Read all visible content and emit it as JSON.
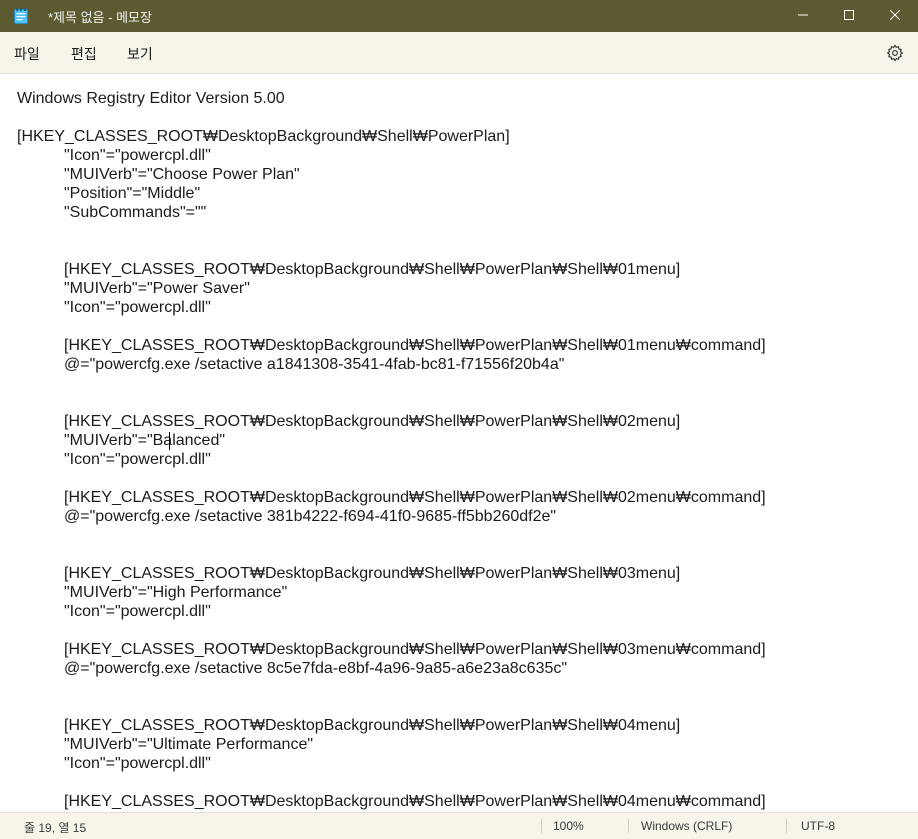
{
  "window": {
    "title": "*제목 없음 - 메모장",
    "icon": "notepad-icon",
    "controls": {
      "minimize_icon": "minimize-icon",
      "maximize_icon": "maximize-icon",
      "close_icon": "close-icon"
    },
    "titlebar_color": "#5b5a31"
  },
  "menu": {
    "items": [
      "파일",
      "편집",
      "보기"
    ],
    "settings_icon": "gear-icon",
    "background_color": "#f7f4ea"
  },
  "editor": {
    "lines": [
      "Windows Registry Editor Version 5.00",
      "",
      "[HKEY_CLASSES_ROOT₩DesktopBackground₩Shell₩PowerPlan]",
      "\"Icon\"=\"powercpl.dll\"",
      "\"MUIVerb\"=\"Choose Power Plan\"",
      "\"Position\"=\"Middle\"",
      "\"SubCommands\"=\"\"",
      "",
      "",
      "[HKEY_CLASSES_ROOT₩DesktopBackground₩Shell₩PowerPlan₩Shell₩01menu]",
      "\"MUIVerb\"=\"Power Saver\"",
      "\"Icon\"=\"powercpl.dll\"",
      "",
      "[HKEY_CLASSES_ROOT₩DesktopBackground₩Shell₩PowerPlan₩Shell₩01menu₩command]",
      "@=\"powercfg.exe /setactive a1841308-3541-4fab-bc81-f71556f20b4a\"",
      "",
      "",
      "[HKEY_CLASSES_ROOT₩DesktopBackground₩Shell₩PowerPlan₩Shell₩02menu]",
      "\"MUIVerb\"=\"Balanced\"",
      "\"Icon\"=\"powercpl.dll\"",
      "",
      "[HKEY_CLASSES_ROOT₩DesktopBackground₩Shell₩PowerPlan₩Shell₩02menu₩command]",
      "@=\"powercfg.exe /setactive 381b4222-f694-41f0-9685-ff5bb260df2e\"",
      "",
      "",
      "[HKEY_CLASSES_ROOT₩DesktopBackground₩Shell₩PowerPlan₩Shell₩03menu]",
      "\"MUIVerb\"=\"High Performance\"",
      "\"Icon\"=\"powercpl.dll\"",
      "",
      "[HKEY_CLASSES_ROOT₩DesktopBackground₩Shell₩PowerPlan₩Shell₩03menu₩command]",
      "@=\"powercfg.exe /setactive 8c5e7fda-e8bf-4a96-9a85-a6e23a8c635c\"",
      "",
      "",
      "[HKEY_CLASSES_ROOT₩DesktopBackground₩Shell₩PowerPlan₩Shell₩04menu]",
      "\"MUIVerb\"=\"Ultimate Performance\"",
      "\"Icon\"=\"powercpl.dll\"",
      "",
      "[HKEY_CLASSES_ROOT₩DesktopBackground₩Shell₩PowerPlan₩Shell₩04menu₩command]"
    ],
    "caret": {
      "line": 19,
      "column": 15
    }
  },
  "status": {
    "position": "줄 19, 열 15",
    "zoom": "100%",
    "line_ending": "Windows (CRLF)",
    "encoding": "UTF-8"
  }
}
